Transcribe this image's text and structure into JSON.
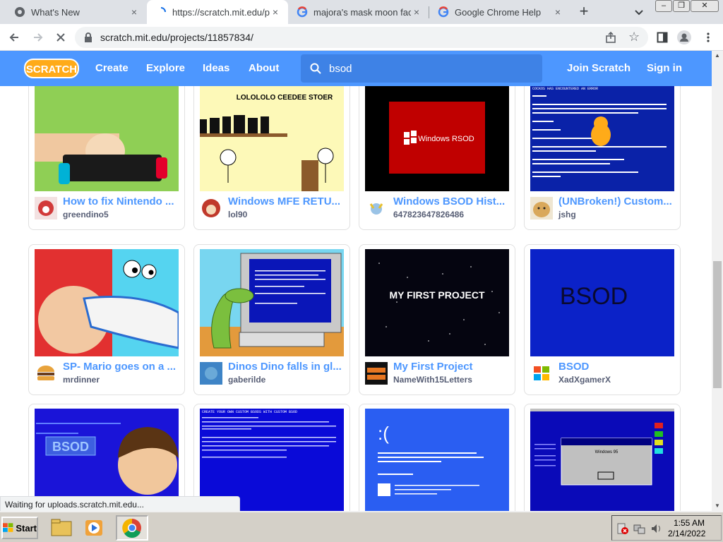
{
  "browser": {
    "tabs": [
      {
        "label": "What's New",
        "close": "×"
      },
      {
        "label": "https://scratch.mit.edu/p",
        "close": "×"
      },
      {
        "label": "majora's mask moon face",
        "close": "×"
      },
      {
        "label": "Google Chrome Help",
        "close": "×"
      }
    ],
    "new_tab": "+",
    "url": "scratch.mit.edu/projects/11857834/"
  },
  "scratch_nav": {
    "logo": "SCRATCH",
    "links": [
      "Create",
      "Explore",
      "Ideas",
      "About"
    ],
    "search_value": "bsod",
    "join": "Join Scratch",
    "signin": "Sign in"
  },
  "projects": [
    {
      "title": "How to fix Nintendo ...",
      "user": "greendino5"
    },
    {
      "title": "Windows MFE RETU...",
      "user": "lol90",
      "thumb_text": "LOLOLOLO CEEDEE STOER"
    },
    {
      "title": "Windows BSOD Hist...",
      "user": "647823647826486",
      "thumb_text": "Windows RSOD"
    },
    {
      "title": "(UNBroken!) Custom...",
      "user": "jshg",
      "thumb_text": "COCKOS HAS ENCOUNTERED AN ERROR"
    },
    {
      "title": "SP- Mario goes on a ...",
      "user": "mrdinner"
    },
    {
      "title": "Dinos Dino falls in gl...",
      "user": "gaberilde"
    },
    {
      "title": "My First Project",
      "user": "NameWith15Letters",
      "thumb_text": "MY FIRST PROJECT"
    },
    {
      "title": "BSOD",
      "user": "XadXgamerX",
      "thumb_text": "BSOD"
    },
    {
      "title": "",
      "user": "",
      "thumb_text": "BSOD"
    },
    {
      "title": "",
      "user": "",
      "thumb_text": "CREATE YOUR OWN CUSTOM BSODS WITH CUSTOM BSOD"
    },
    {
      "title": "",
      "user": "",
      "thumb_text": ":("
    },
    {
      "title": "",
      "user": "",
      "thumb_text": "Windows 95"
    }
  ],
  "status_text": "Waiting for uploads.scratch.mit.edu...",
  "taskbar": {
    "start": "Start",
    "time": "1:55 AM",
    "date": "2/14/2022"
  },
  "colors": {
    "scratch_blue": "#4d97ff",
    "bsod_blue": "#0000aa"
  }
}
